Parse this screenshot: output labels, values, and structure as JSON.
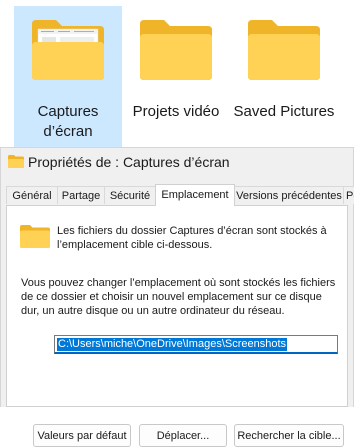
{
  "explorer": {
    "items": [
      {
        "label": "Captures d’écran",
        "selected": true,
        "has_preview": true
      },
      {
        "label": "Projets vidéo",
        "selected": false,
        "has_preview": false
      },
      {
        "label": "Saved Pictures",
        "selected": false,
        "has_preview": false
      }
    ]
  },
  "dialog": {
    "title": "Propriétés de : Captures d’écran",
    "tabs": [
      "Général",
      "Partage",
      "Sécurité",
      "Emplacement",
      "Versions précédentes",
      "Pe"
    ],
    "active_tab": "Emplacement",
    "info_text": "Les fichiers du dossier Captures d’écran sont stockés à l’emplacement cible ci-dessous.",
    "description": "Vous pouvez changer l’emplacement où sont stockés les fichiers de ce dossier et choisir un nouvel emplacement sur ce disque dur, un autre disque ou un autre ordinateur du réseau.",
    "path_value": "C:\\Users\\miche\\OneDrive\\Images\\Screenshots",
    "buttons": {
      "restore_default": "Valeurs par défaut",
      "move": "Déplacer...",
      "find_target": "Rechercher la cible..."
    }
  },
  "colors": {
    "folder_front": "#ffd154",
    "folder_back": "#f0b429",
    "selection": "#cce8ff",
    "text_highlight": "#0078d7"
  }
}
